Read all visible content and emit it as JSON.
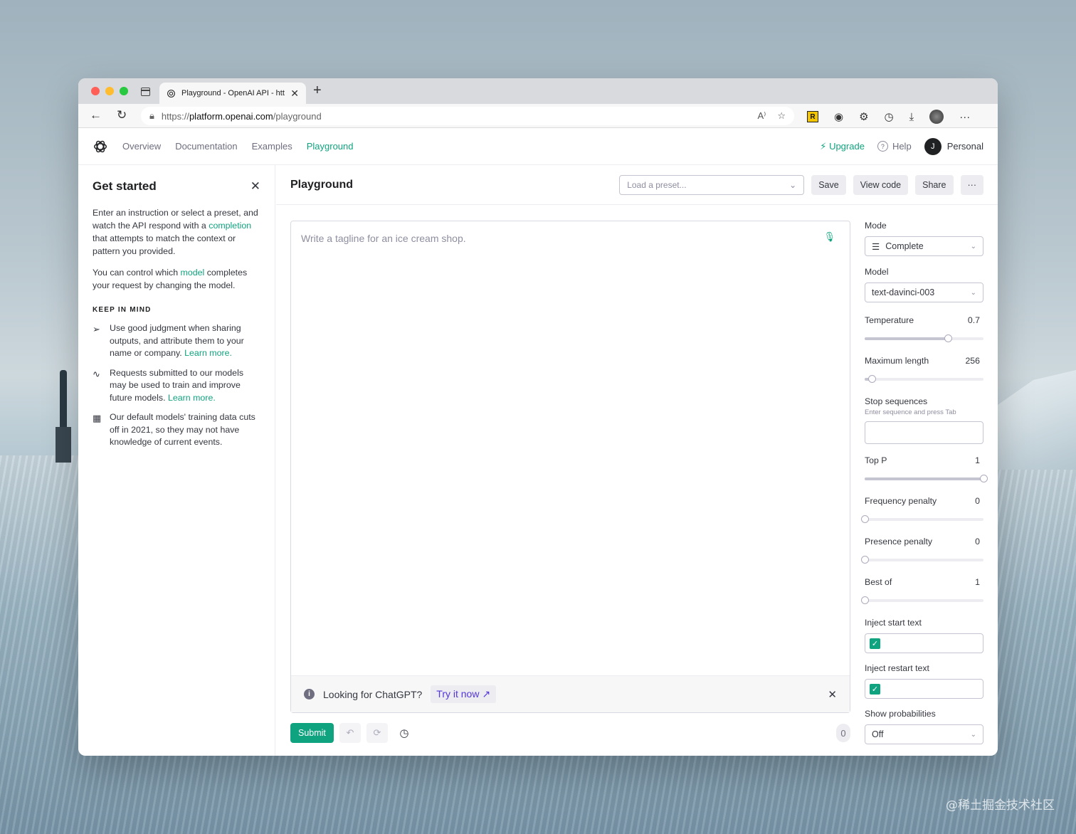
{
  "browser": {
    "tab_title": "Playground - OpenAI API - https://platform.openai.com/playground",
    "url_prefix": "https://",
    "url_domain": "platform.openai.com",
    "url_path": "/playground"
  },
  "header": {
    "nav": [
      "Overview",
      "Documentation",
      "Examples",
      "Playground"
    ],
    "active_nav": "Playground",
    "upgrade": "Upgrade",
    "help": "Help",
    "avatar_initial": "J",
    "account": "Personal"
  },
  "sidebar": {
    "title": "Get started",
    "p1_a": "Enter an instruction or select a preset, and watch the API respond with a ",
    "p1_link": "completion",
    "p1_b": " that attempts to match the context or pattern you provided.",
    "p2_a": "You can control which ",
    "p2_link": "model",
    "p2_b": " completes your request by changing the model.",
    "keep_heading": "KEEP IN MIND",
    "tip1": "Use good judgment when sharing outputs, and attribute them to your name or company. ",
    "tip2": "Requests submitted to our models may be used to train and improve future models. ",
    "tip3": "Our default models' training data cuts off in 2021, so they may not have knowledge of current events.",
    "learn_more": "Learn more."
  },
  "main": {
    "title": "Playground",
    "preset_placeholder": "Load a preset...",
    "save": "Save",
    "view_code": "View code",
    "share": "Share",
    "more": "···",
    "editor_placeholder": "Write a tagline for an ice cream shop.",
    "banner_text": "Looking for ChatGPT?",
    "banner_link": "Try it now",
    "submit": "Submit",
    "token_count": "0"
  },
  "settings": {
    "mode_label": "Mode",
    "mode_value": "Complete",
    "model_label": "Model",
    "model_value": "text-davinci-003",
    "temperature_label": "Temperature",
    "temperature": "0.7",
    "temperature_fraction": 0.7,
    "max_length_label": "Maximum length",
    "max_length": "256",
    "max_length_fraction": 0.06,
    "stop_label": "Stop sequences",
    "stop_hint": "Enter sequence and press Tab",
    "top_p_label": "Top P",
    "top_p": "1",
    "top_p_fraction": 1.0,
    "freq_label": "Frequency penalty",
    "freq": "0",
    "freq_fraction": 0,
    "presence_label": "Presence penalty",
    "presence": "0",
    "presence_fraction": 0,
    "best_of_label": "Best of",
    "best_of": "1",
    "best_of_fraction": 0,
    "inject_start_label": "Inject start text",
    "inject_restart_label": "Inject restart text",
    "show_prob_label": "Show probabilities",
    "show_prob_value": "Off"
  },
  "watermark": "@稀土掘金技术社区",
  "colors": {
    "accent": "#10a37f",
    "link_purple": "#5436da"
  }
}
